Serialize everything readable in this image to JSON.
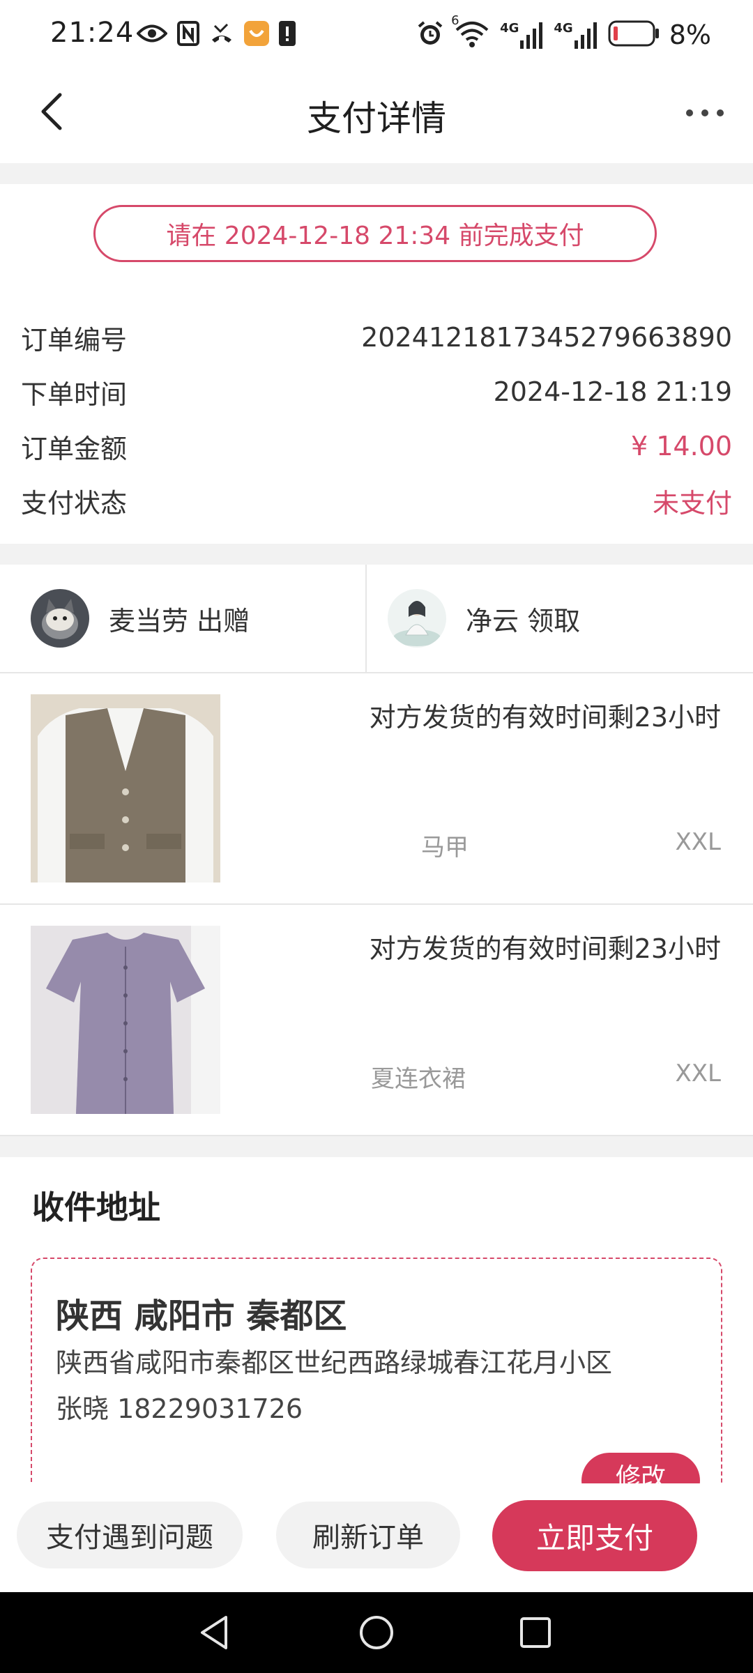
{
  "status_bar": {
    "time": "21:24",
    "battery_percent": "8%",
    "network_label_1": "4G",
    "network_label_2": "4G",
    "wifi_badge": "6",
    "icons": [
      "eye-icon",
      "nfc-icon",
      "missed-call-icon",
      "app-notification-icon",
      "sim-alert-icon",
      "alarm-icon",
      "wifi-icon",
      "signal-icon",
      "battery-icon"
    ]
  },
  "header": {
    "title": "支付详情",
    "back_icon": "chevron-left-icon",
    "more_icon": "more-horizontal-icon"
  },
  "deadline": {
    "text": "请在 2024-12-18 21:34 前完成支付"
  },
  "order_info": [
    {
      "label": "订单编号",
      "value": "20241218173452796638​90"
    },
    {
      "label": "下单时间",
      "value": "2024-12-18 21:19"
    },
    {
      "label": "订单金额",
      "value": "¥ 14.00"
    },
    {
      "label": "支付状态",
      "value": "未支付"
    }
  ],
  "gift": {
    "giver": "麦当劳 出赠",
    "receiver": "净云 领取"
  },
  "items": [
    {
      "note": "对方发货的有效时间剩23小时",
      "name": "马甲",
      "size": "XXL"
    },
    {
      "note": "对方发货的有效时间剩23小时",
      "name": "夏连衣裙",
      "size": "XXL"
    }
  ],
  "address": {
    "section_title": "收件地址",
    "region": "陕西 咸阳市 秦都区",
    "detail": "陕西省咸阳市秦都区世纪西路绿城春江花月小区",
    "contact": "张晓 18229031726",
    "edit_label": "修改"
  },
  "actions": {
    "problem_label": "支付遇到问题",
    "refresh_label": "刷新订单",
    "pay_label": "立即支付"
  },
  "colors": {
    "accent": "#d6395a",
    "accent_text": "#d6496a",
    "band": "#f2f2f2"
  }
}
